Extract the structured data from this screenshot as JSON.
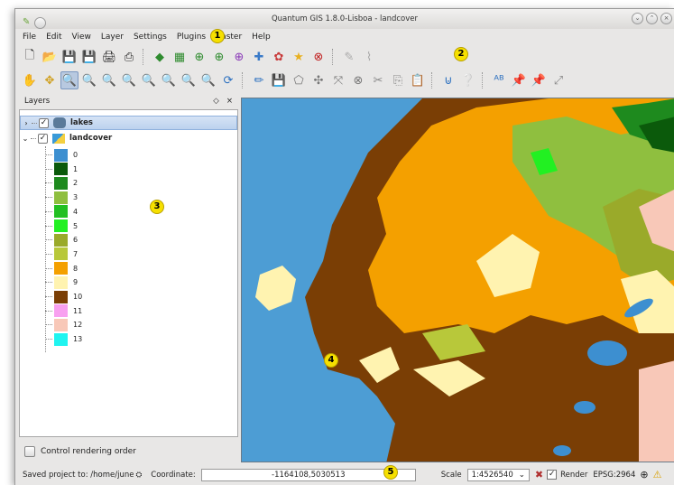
{
  "window": {
    "title": "Quantum GIS 1.8.0-Lisboa - landcover"
  },
  "menu": [
    "File",
    "Edit",
    "View",
    "Layer",
    "Settings",
    "Plugins",
    "Raster",
    "Help"
  ],
  "callouts": [
    "1",
    "2",
    "3",
    "4",
    "5"
  ],
  "layers_panel": {
    "title": "Layers",
    "float_icon": "◇",
    "close_icon": "×",
    "layers": [
      {
        "name": "lakes",
        "checked": true,
        "expanded": false,
        "selected": true
      },
      {
        "name": "landcover",
        "checked": true,
        "expanded": true,
        "selected": false
      }
    ],
    "legend": [
      {
        "label": "0",
        "color": "#3d8fd0"
      },
      {
        "label": "1",
        "color": "#0b5a0b"
      },
      {
        "label": "2",
        "color": "#1e8a1e"
      },
      {
        "label": "3",
        "color": "#8fbf3f"
      },
      {
        "label": "4",
        "color": "#22c022"
      },
      {
        "label": "5",
        "color": "#22f022"
      },
      {
        "label": "6",
        "color": "#9aaa2a"
      },
      {
        "label": "7",
        "color": "#b8c83a"
      },
      {
        "label": "8",
        "color": "#f4a000"
      },
      {
        "label": "9",
        "color": "#fff3b0"
      },
      {
        "label": "10",
        "color": "#7a3e05"
      },
      {
        "label": "11",
        "color": "#f8a0f0"
      },
      {
        "label": "12",
        "color": "#f8c8b8"
      },
      {
        "label": "13",
        "color": "#20f4f0"
      }
    ],
    "control_rendering_order": "Control rendering order"
  },
  "status": {
    "saved": "Saved project to: /home/june",
    "coordinate_label": "Coordinate:",
    "coordinate_value": "-1164108,5030513",
    "scale_label": "Scale",
    "scale_value": "1:4526540",
    "render_label": "Render",
    "epsg": "EPSG:2964"
  }
}
